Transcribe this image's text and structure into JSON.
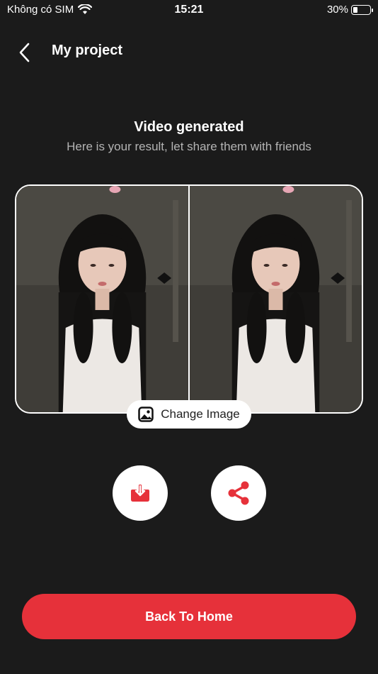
{
  "status_bar": {
    "carrier": "Không có SIM",
    "time": "15:21",
    "battery_percent": "30%",
    "battery_level": 0.3
  },
  "header": {
    "title": "My project",
    "back_icon": "chevron-left-icon"
  },
  "result": {
    "title": "Video generated",
    "subtitle": "Here is your result, let share them with friends"
  },
  "preview": {
    "left_image": "original-portrait",
    "right_image": "generated-portrait"
  },
  "actions": {
    "change_image_label": "Change Image",
    "change_image_icon": "image-icon",
    "download_icon": "download-icon",
    "share_icon": "share-icon",
    "back_home_label": "Back To Home"
  },
  "colors": {
    "background": "#1b1b1b",
    "accent": "#e6313a",
    "text": "#ffffff",
    "subtext": "#b4b4b4"
  }
}
